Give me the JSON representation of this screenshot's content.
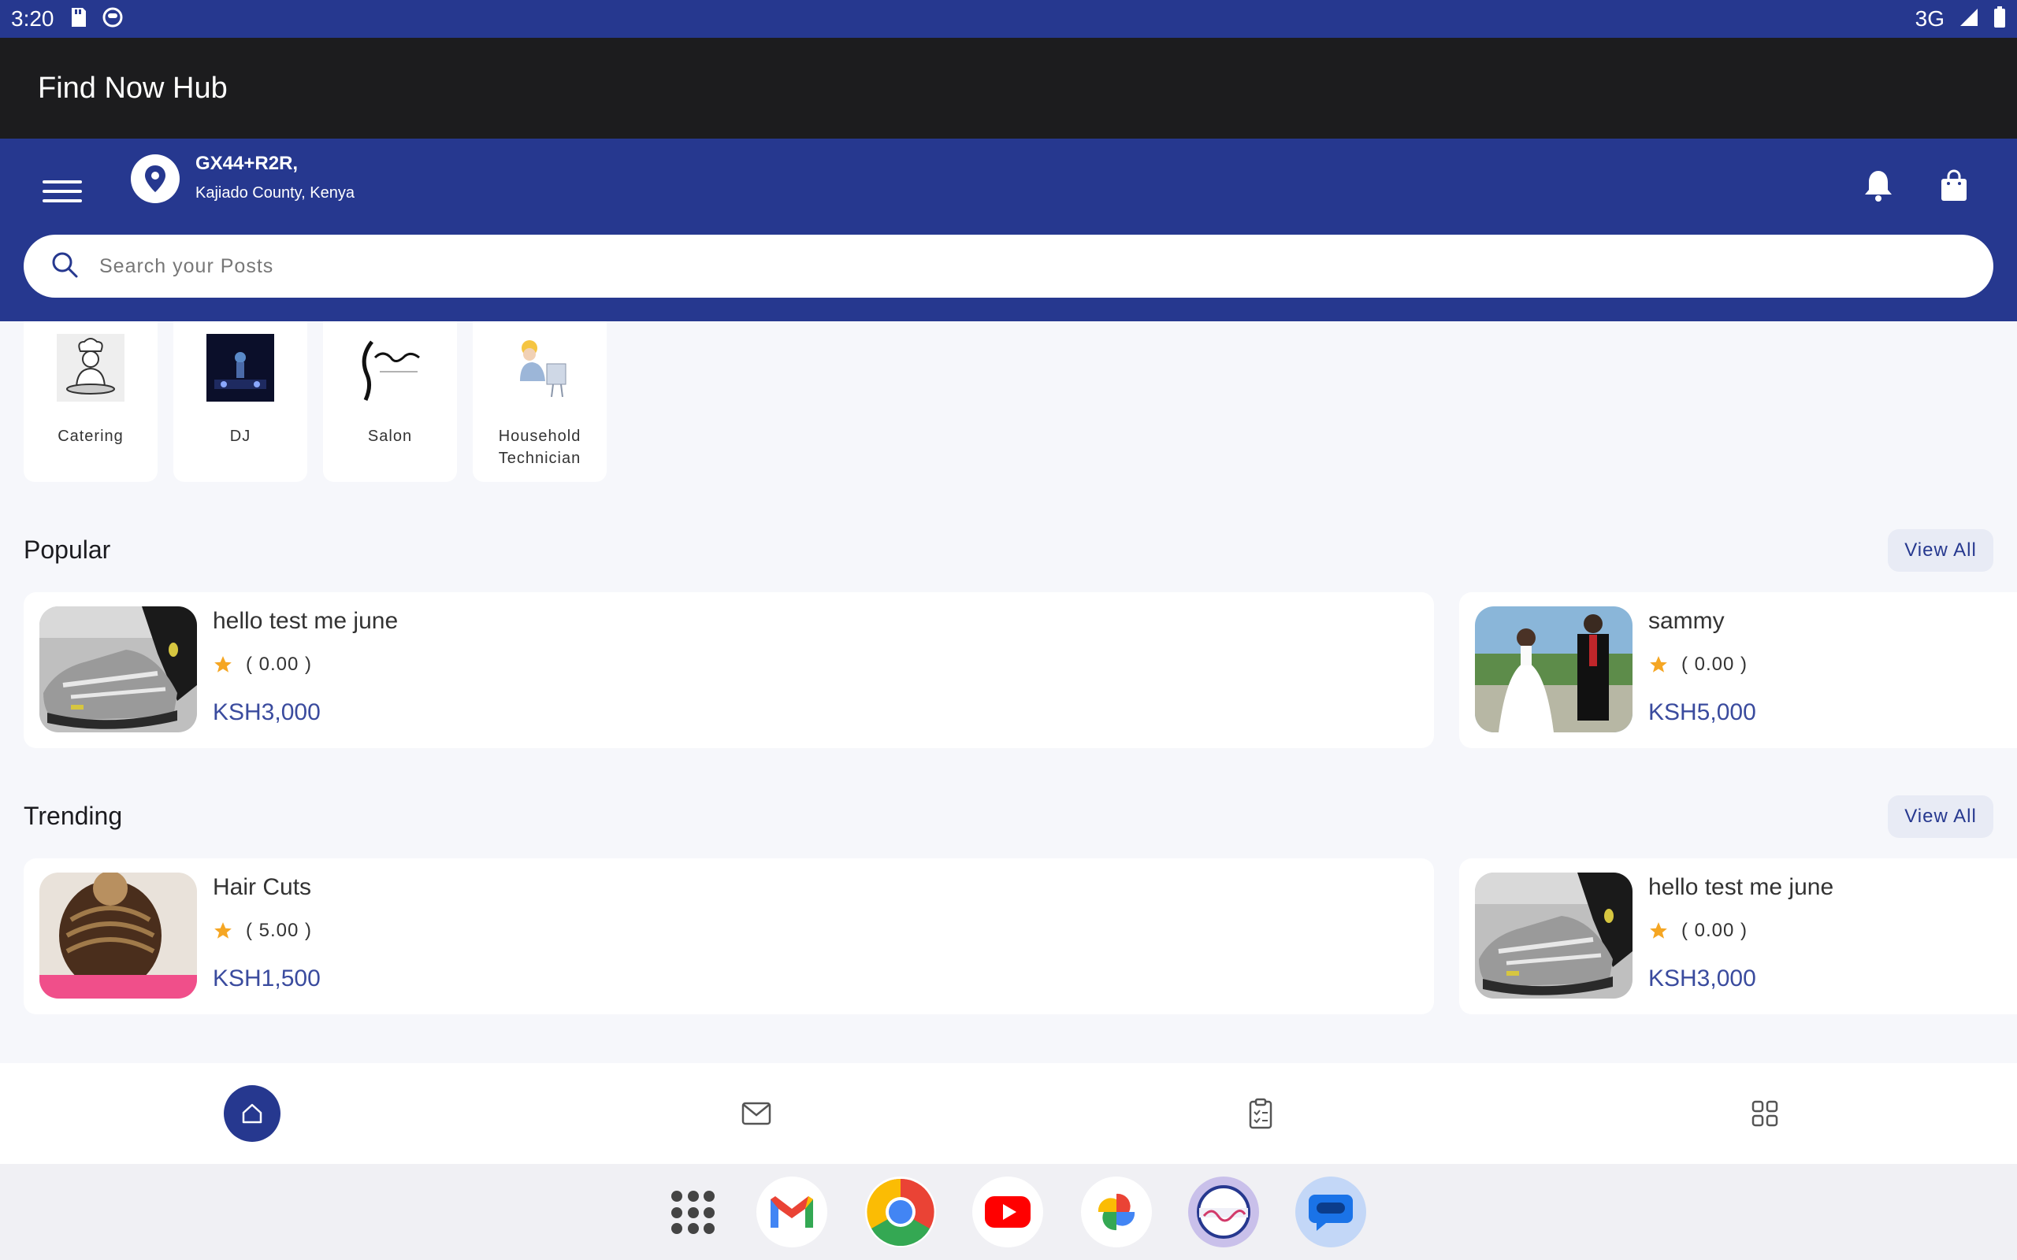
{
  "status_bar": {
    "time": "3:20",
    "network": "3G"
  },
  "app": {
    "title": "Find Now Hub"
  },
  "header": {
    "location_line1": "GX44+R2R,",
    "location_line2": "Kajiado County, Kenya"
  },
  "search": {
    "placeholder": "Search your Posts"
  },
  "categories": [
    {
      "label": "Catering",
      "icon": "chef-icon"
    },
    {
      "label": "DJ",
      "icon": "dj-icon"
    },
    {
      "label": "Salon",
      "icon": "salon-logo"
    },
    {
      "label": "Household Technician",
      "icon": "technician-icon"
    }
  ],
  "popular": {
    "title": "Popular",
    "view_all": "View All",
    "items": [
      {
        "title": "hello test me june",
        "rating": "( 0.00 )",
        "price": "KSH3,000",
        "image": "sneaker"
      },
      {
        "title": "sammy",
        "rating": "( 0.00 )",
        "price": "KSH5,000",
        "image": "wedding-couple"
      }
    ]
  },
  "trending": {
    "title": "Trending",
    "view_all": "View All",
    "items": [
      {
        "title": "Hair Cuts",
        "rating": "( 5.00 )",
        "price": "KSH1,500",
        "image": "braided-hair"
      },
      {
        "title": "hello test me june",
        "rating": "( 0.00 )",
        "price": "KSH3,000",
        "image": "sneaker"
      }
    ]
  },
  "bottom_nav": [
    "home-icon",
    "mail-icon",
    "clipboard-icon",
    "grid-icon"
  ],
  "taskbar_apps": [
    "app-drawer-icon",
    "gmail-icon",
    "chrome-icon",
    "youtube-icon",
    "photos-icon",
    "findnow-icon",
    "messages-icon"
  ],
  "colors": {
    "primary": "#26388f",
    "title_bar": "#1c1c1e",
    "price": "#3a4b9e",
    "star": "#f5a623",
    "background": "#f6f7fb"
  }
}
